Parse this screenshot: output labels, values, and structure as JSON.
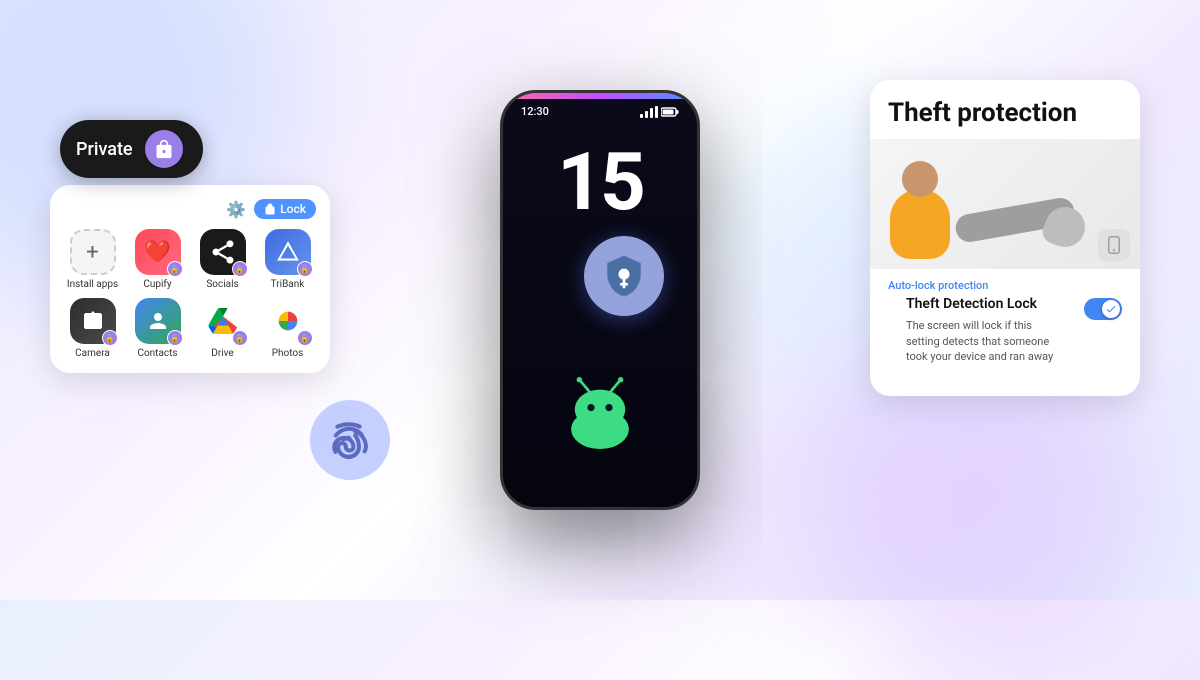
{
  "background": {
    "color_start": "#e8f0fe",
    "color_mid": "#f8f0ff",
    "color_end": "#e8f0fe"
  },
  "phone": {
    "time": "12:30",
    "number": "15",
    "signal_icon": "📶"
  },
  "private_space": {
    "label": "Private",
    "icon": "🔒"
  },
  "app_grid": {
    "lock_button_label": "Lock",
    "apps": [
      {
        "name": "Install apps",
        "type": "install",
        "has_lock": false
      },
      {
        "name": "Cupify",
        "type": "cupify",
        "has_lock": true
      },
      {
        "name": "Socials",
        "type": "socials",
        "has_lock": true
      },
      {
        "name": "TriBank",
        "type": "tribank",
        "has_lock": true
      },
      {
        "name": "Camera",
        "type": "camera",
        "has_lock": true
      },
      {
        "name": "Contacts",
        "type": "contacts",
        "has_lock": true
      },
      {
        "name": "Drive",
        "type": "drive",
        "has_lock": true
      },
      {
        "name": "Photos",
        "type": "photos",
        "has_lock": true
      }
    ]
  },
  "theft_card": {
    "title": "Theft protection",
    "label": "Auto-lock protection",
    "feature_title": "Theft Detection Lock",
    "description": "The screen will lock if this setting detects that someone took your device and ran away",
    "toggle_on": true
  },
  "shield": {
    "icon_label": "shield-key-icon"
  },
  "fingerprint": {
    "icon_label": "fingerprint-icon"
  }
}
